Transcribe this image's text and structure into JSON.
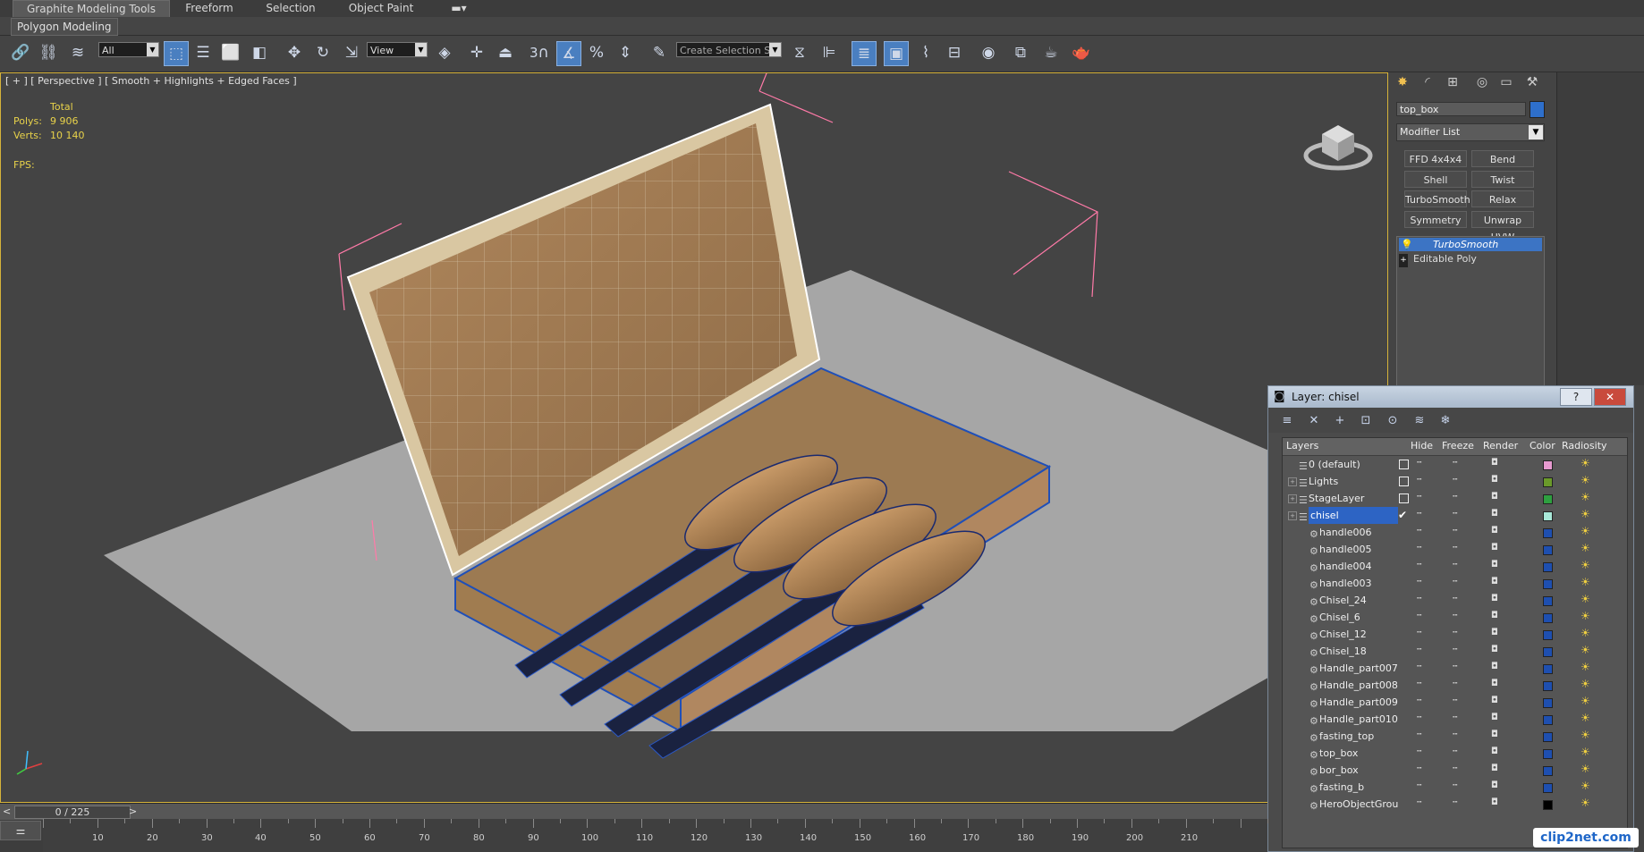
{
  "ribbon": {
    "tabs": [
      "Graphite Modeling Tools",
      "Freeform",
      "Selection",
      "Object Paint"
    ],
    "sub_label": "Polygon Modeling"
  },
  "toolbar": {
    "filter_value": "All",
    "refcoord_value": "View",
    "snap_3d_label": "3",
    "named_selection_placeholder": "Create Selection Se"
  },
  "viewport": {
    "label": "[ + ] [ Perspective ] [ Smooth + Highlights + Edged Faces ]",
    "stats": {
      "header": "Total",
      "polys_label": "Polys:",
      "polys_value": "9 906",
      "verts_label": "Verts:",
      "verts_value": "10 140",
      "fps_label": "FPS:"
    }
  },
  "command_panel": {
    "object_name": "top_box",
    "object_color": "#2e6fcb",
    "modifier_list_label": "Modifier List",
    "modifier_buttons": [
      "FFD 4x4x4",
      "Bend",
      "Shell",
      "Twist",
      "TurboSmooth",
      "Relax",
      "Symmetry",
      "Unwrap UVW"
    ],
    "stack": [
      {
        "label": "TurboSmooth",
        "selected": true
      },
      {
        "label": "Editable Poly",
        "selected": false
      }
    ]
  },
  "layer_dialog": {
    "title": "Layer: chisel",
    "help_label": "?",
    "close_label": "✕",
    "columns": [
      "Layers",
      "Hide",
      "Freeze",
      "Render",
      "Color",
      "Radiosity"
    ],
    "rows": [
      {
        "name": "0 (default)",
        "level": 0,
        "color": "#e79ad0",
        "expandable": false,
        "checkbox": true,
        "selected": false
      },
      {
        "name": "Lights",
        "level": 0,
        "color": "#6a9a2a",
        "expandable": true,
        "checkbox": true,
        "selected": false
      },
      {
        "name": "StageLayer",
        "level": 0,
        "color": "#2ea040",
        "expandable": true,
        "checkbox": true,
        "selected": false
      },
      {
        "name": "chisel",
        "level": 0,
        "color": "#a8e8d8",
        "expandable": true,
        "checkbox": false,
        "selected": true
      },
      {
        "name": "handle006",
        "level": 1,
        "color": "#1e4fb0"
      },
      {
        "name": "handle005",
        "level": 1,
        "color": "#1e4fb0"
      },
      {
        "name": "handle004",
        "level": 1,
        "color": "#1e4fb0"
      },
      {
        "name": "handle003",
        "level": 1,
        "color": "#1e4fb0"
      },
      {
        "name": "Chisel_24",
        "level": 1,
        "color": "#1e4fb0"
      },
      {
        "name": "Chisel_6",
        "level": 1,
        "color": "#1e4fb0"
      },
      {
        "name": "Chisel_12",
        "level": 1,
        "color": "#1e4fb0"
      },
      {
        "name": "Chisel_18",
        "level": 1,
        "color": "#1e4fb0"
      },
      {
        "name": "Handle_part007",
        "level": 1,
        "color": "#1e4fb0"
      },
      {
        "name": "Handle_part008",
        "level": 1,
        "color": "#1e4fb0"
      },
      {
        "name": "Handle_part009",
        "level": 1,
        "color": "#1e4fb0"
      },
      {
        "name": "Handle_part010",
        "level": 1,
        "color": "#1e4fb0"
      },
      {
        "name": "fasting_top",
        "level": 1,
        "color": "#1e4fb0"
      },
      {
        "name": "top_box",
        "level": 1,
        "color": "#1e4fb0"
      },
      {
        "name": "bor_box",
        "level": 1,
        "color": "#1e4fb0"
      },
      {
        "name": "fasting_b",
        "level": 1,
        "color": "#1e4fb0"
      },
      {
        "name": "HeroObjectGrou",
        "level": 1,
        "color": "#000000"
      }
    ]
  },
  "timeline": {
    "frame_label": "0 / 225",
    "prev_label": "<",
    "next_label": ">",
    "tick_labels": [
      "10",
      "20",
      "30",
      "40",
      "50",
      "60",
      "70",
      "80",
      "90",
      "100",
      "110",
      "120",
      "130",
      "140",
      "150",
      "160",
      "170",
      "180",
      "190",
      "200",
      "210"
    ]
  },
  "watermark": "clip2net.com"
}
